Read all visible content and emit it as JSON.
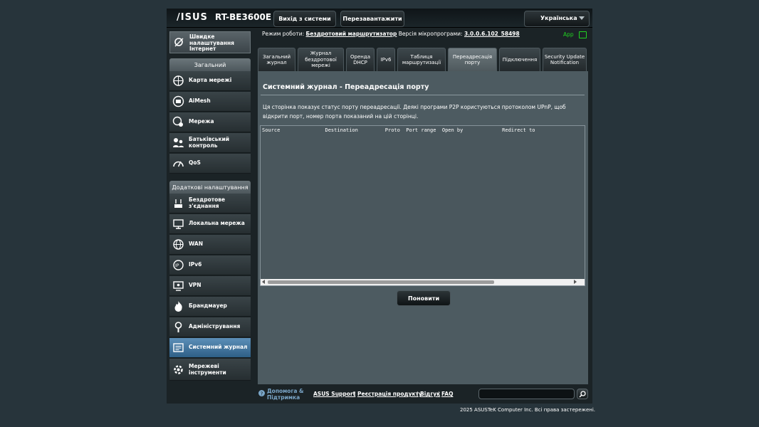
{
  "header": {
    "logo": "/ISUS",
    "model": "RT-BE3600E",
    "logout_label": "Вихід з системи",
    "reboot_label": "Перезавантажити",
    "language": "Українська"
  },
  "status_bar": {
    "mode_label": "Режим роботи:",
    "mode_value": "Бездротовий маршрутизатор",
    "firmware_label": "Версія мікропрограми:",
    "firmware_value": "3.0.0.6.102_58498",
    "app_label": "App"
  },
  "sidebar": {
    "quick_internet": "Швидке налаштування Інтернет",
    "general_header": "Загальний",
    "general_items": [
      {
        "label": "Карта мережі",
        "icon": "network-map-icon"
      },
      {
        "label": "AiMesh",
        "icon": "aimesh-icon"
      },
      {
        "label": "Мережа",
        "icon": "guest-network-icon"
      },
      {
        "label": "Батьківський контроль",
        "icon": "parental-control-icon"
      },
      {
        "label": "QoS",
        "icon": "qos-icon"
      }
    ],
    "advanced_header": "Додаткові налаштування",
    "advanced_items": [
      {
        "label": "Бездротове з'єднання",
        "icon": "wireless-icon"
      },
      {
        "label": "Локальна мережа",
        "icon": "lan-icon"
      },
      {
        "label": "WAN",
        "icon": "wan-icon"
      },
      {
        "label": "IPv6",
        "icon": "ipv6-icon"
      },
      {
        "label": "VPN",
        "icon": "vpn-icon"
      },
      {
        "label": "Брандмауер",
        "icon": "firewall-icon"
      },
      {
        "label": "Адміністрування",
        "icon": "administration-icon"
      },
      {
        "label": "Системний журнал",
        "icon": "system-log-icon"
      },
      {
        "label": "Мережеві інструменти",
        "icon": "network-tools-icon"
      }
    ]
  },
  "tabs": [
    {
      "label": "Загальний журнал"
    },
    {
      "label": "Журнал бездротової мережі"
    },
    {
      "label": "Оренда DHCP"
    },
    {
      "label": "IPv6"
    },
    {
      "label": "Таблиця маршрутизації"
    },
    {
      "label": "Переадресація порту"
    },
    {
      "label": "Підключення"
    },
    {
      "label": "Security Update Notification"
    }
  ],
  "main": {
    "title": "Системний журнал - Переадресація порту",
    "description": "Ця сторінка показує статус порту переадресації. Деякі програми P2P користуються протоколом UPnP, щоб відкрити порт, номер порта показаний на цій сторінці.",
    "log_header": "Source               Destination         Proto  Port range  Open by             Redirect to",
    "refresh_label": "Поновити"
  },
  "footer": {
    "help_label": "Допомога & Підтримка",
    "links": [
      "ASUS Support",
      "Реєстрація продукту",
      "Відгук",
      "FAQ"
    ],
    "copyright": "2025 ASUSTeK Computer Inc. Всі права застережені."
  },
  "colors": {
    "background": "#27343b",
    "panel": "#4d5b61",
    "active_menu": "#3f77a6",
    "app_green": "#21d221"
  }
}
